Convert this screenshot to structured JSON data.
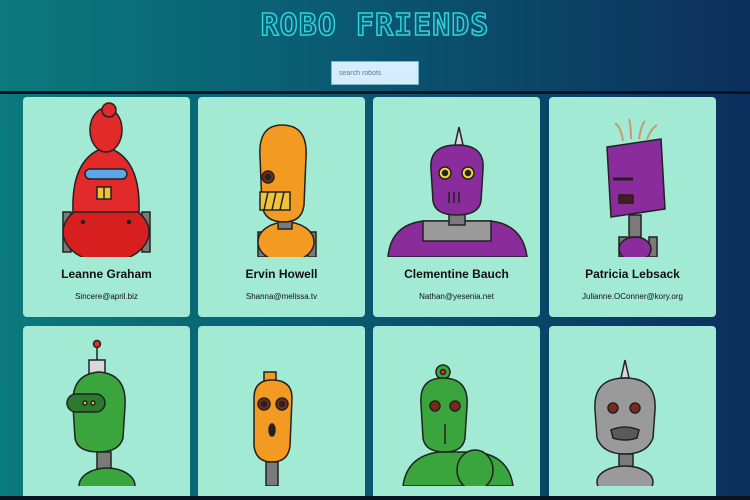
{
  "app": {
    "title": "ROBO FRIENDS"
  },
  "search": {
    "placeholder": "search robots",
    "value": ""
  },
  "robots": [
    {
      "name": "Leanne Graham",
      "email": "Sincere@april.biz",
      "color": "#e32a2a"
    },
    {
      "name": "Ervin Howell",
      "email": "Shanna@melissa.tv",
      "color": "#f29a22"
    },
    {
      "name": "Clementine Bauch",
      "email": "Nathan@yesenia.net",
      "color": "#8a2c9b"
    },
    {
      "name": "Patricia Lebsack",
      "email": "Julianne.OConner@kory.org",
      "color": "#8a2c9b"
    },
    {
      "name": "",
      "email": "",
      "color": "#3aa53c"
    },
    {
      "name": "",
      "email": "",
      "color": "#f29a22"
    },
    {
      "name": "",
      "email": "",
      "color": "#3aa53c"
    },
    {
      "name": "",
      "email": "",
      "color": "#9a9a9a"
    }
  ],
  "colors": {
    "card_bg": "#a2ead4",
    "title_outline": "#2fd4d8"
  }
}
